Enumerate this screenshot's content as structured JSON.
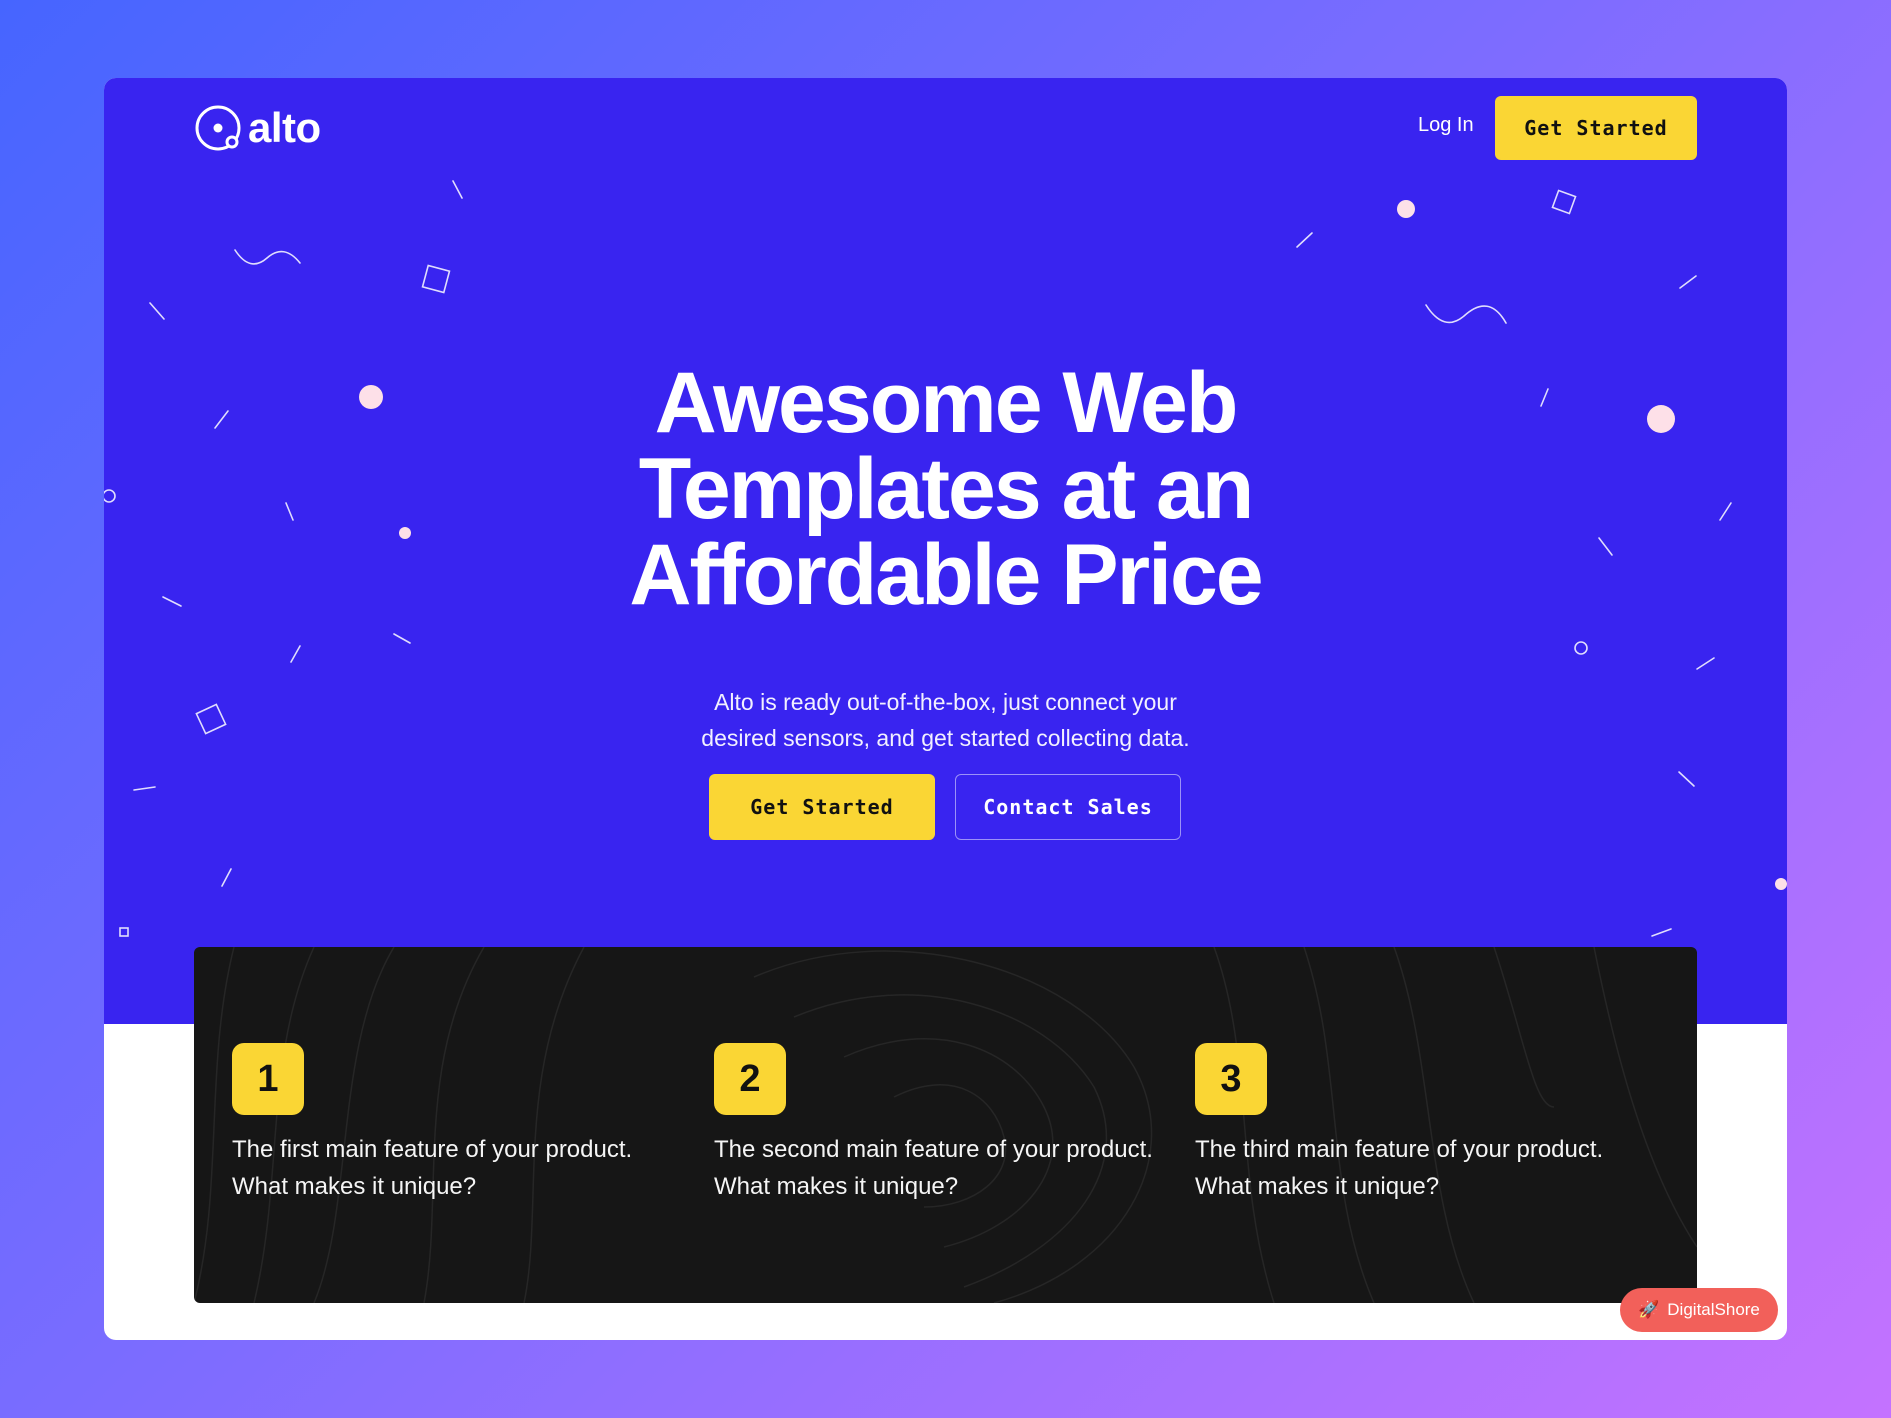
{
  "nav": {
    "brand": "alto",
    "login_label": "Log In",
    "cta_label": "Get Started"
  },
  "hero": {
    "headline_lines": [
      "Awesome Web",
      "Templates at an",
      "Affordable Price"
    ],
    "subtitle_lines": [
      "Alto is ready out-of-the-box, just connect your",
      "desired sensors, and get started collecting data."
    ],
    "primary_cta": "Get Started",
    "secondary_cta": "Contact Sales"
  },
  "features": [
    {
      "number": "1",
      "lines": [
        "The first main feature of your product.",
        "What makes it unique?"
      ]
    },
    {
      "number": "2",
      "lines": [
        "The second main feature of your product.",
        "What makes it unique?"
      ]
    },
    {
      "number": "3",
      "lines": [
        "The third main feature of your product.",
        "What makes it unique?"
      ]
    }
  ],
  "badge": {
    "label": "DigitalShore",
    "icon": "rocket-icon"
  },
  "colors": {
    "hero_bg": "#3924f0",
    "accent_yellow": "#fad634",
    "features_bg": "#161616",
    "badge_bg": "#f2605a",
    "confetti_dot": "#fde0e8"
  }
}
